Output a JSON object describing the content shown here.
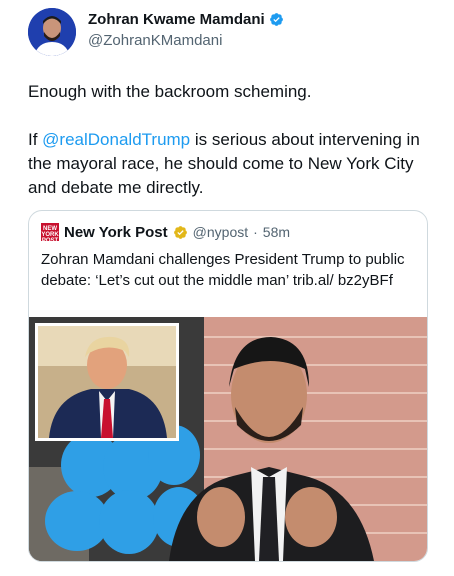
{
  "author": {
    "name": "Zohran Kwame Mamdani",
    "handle": "@ZohranKMamdani"
  },
  "tweet": {
    "line1": "Enough with the backroom scheming.",
    "p2_before": "If ",
    "mention": "@realDonaldTrump",
    "p2_after": " is serious about intervening in the mayoral race, he should come to New York City and debate me directly."
  },
  "quote": {
    "logo_text": "NEW YORK POST",
    "name": "New York Post",
    "handle": "@nypost",
    "separator": "·",
    "time": "58m",
    "text": "Zohran Mamdani challenges President Trump to public debate: ‘Let’s cut out the middle man’ trib.al/ bz2yBFf"
  },
  "colors": {
    "link": "#1d9bf0",
    "verified_blue": "#1d9bf0",
    "verified_gold": "#e2b719",
    "post_red": "#c8102e"
  }
}
